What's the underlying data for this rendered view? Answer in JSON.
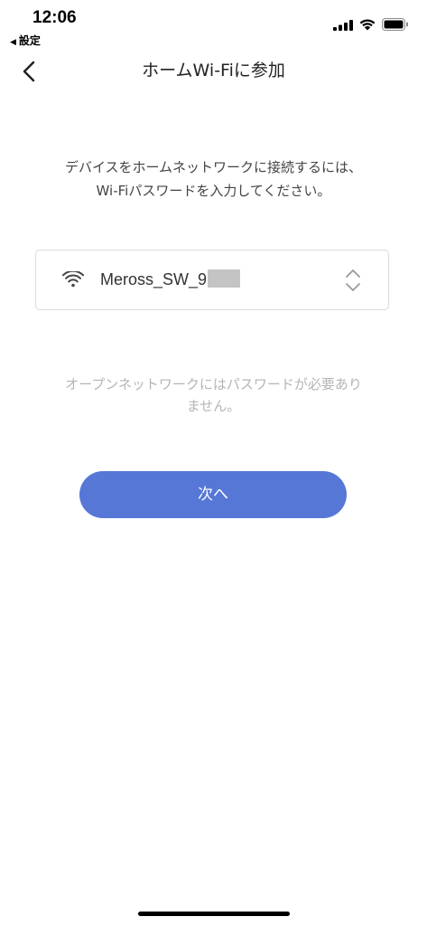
{
  "status_bar": {
    "time": "12:06",
    "back_label": "設定"
  },
  "nav": {
    "title": "ホームWi-Fiに参加"
  },
  "instruction": {
    "line1": "デバイスをホームネットワークに接続するには、",
    "line2": "Wi-Fiパスワードを入力してください。"
  },
  "network": {
    "ssid": "Meross_SW_9"
  },
  "note": {
    "line1": "オープンネットワークにはパスワードが必要あり",
    "line2": "ません。"
  },
  "next_button": {
    "label": "次へ"
  },
  "colors": {
    "primary": "#5677d6",
    "muted_text": "#b5b5b5",
    "border": "#dcdcdc"
  }
}
